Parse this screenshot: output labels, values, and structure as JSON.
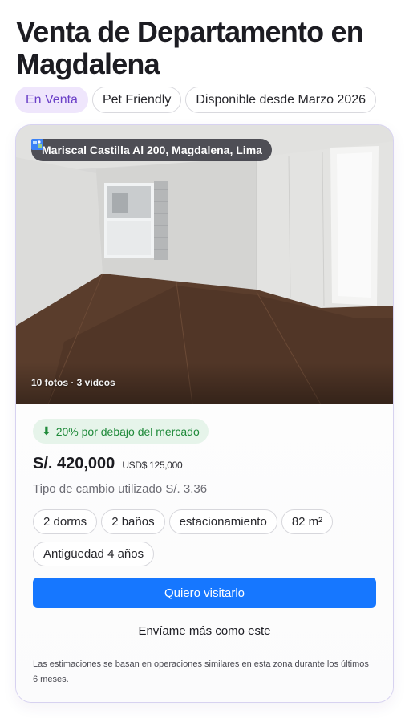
{
  "listing": {
    "title": "Venta de Departamento en Magdalena",
    "chips": [
      "En Venta",
      "Pet Friendly",
      "Disponible desde Marzo 2026"
    ]
  },
  "card": {
    "location": "Mariscal Castilla Al 200, Magdalena, Lima",
    "location_icon": "map-icon",
    "media_count": "10 fotos · 3 videos",
    "market_badge": "20% por debajo del mercado",
    "market_icon": "arrow-down-icon",
    "price": "S/. 420,000",
    "price_usd": "USD$ 125,000",
    "exchange_rate": "Tipo de cambio utilizado S/. 3.36",
    "features": [
      "2 dorms",
      "2 baños",
      "estacionamiento",
      "82 m²",
      "Antigüedad 4 años"
    ],
    "cta_label": "Quiero visitarlo",
    "secondary_label": "Envíame más como este",
    "disclaimer": "Las estimaciones se basan en operaciones similares en esta zona durante los últimos 6 meses."
  },
  "colors": {
    "accent": "#1677ff",
    "sale_chip_bg": "#efe6fc",
    "sale_chip_text": "#6a3fc7",
    "market_bg": "#e6f4ea",
    "market_text": "#1f8a3a"
  }
}
